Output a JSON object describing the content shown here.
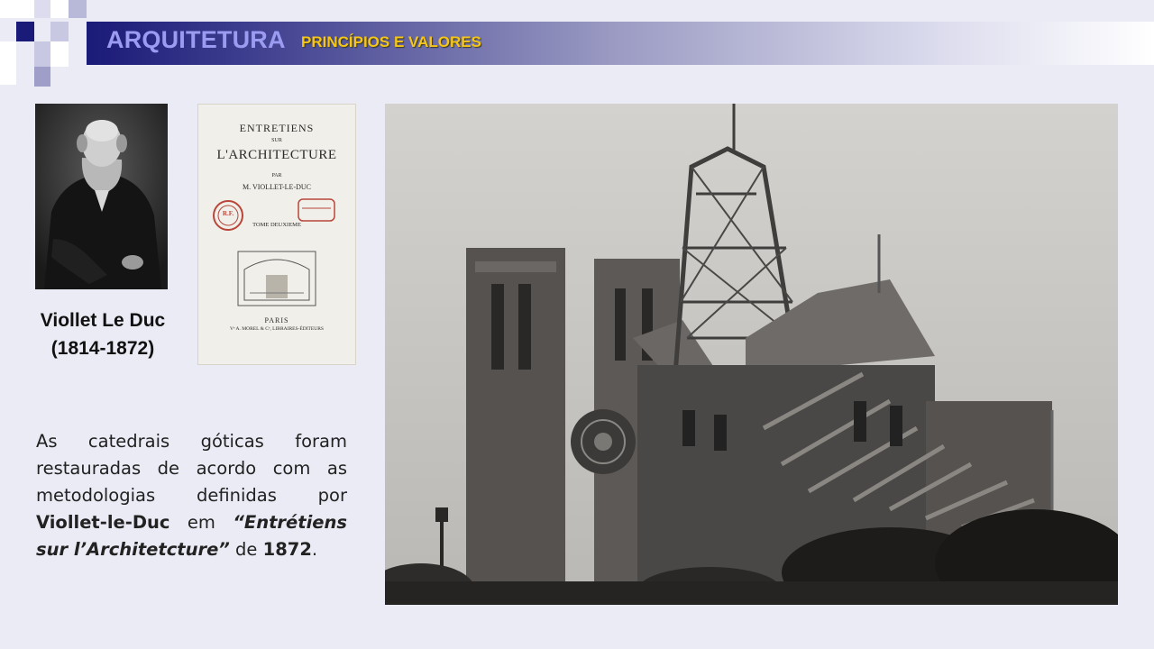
{
  "slide": {
    "title": "ARQUITETURA",
    "subtitle": "PRINCÍPIOS E VALORES"
  },
  "portrait": {
    "caption_name": "Viollet Le Duc",
    "caption_dates": "(1814-1872)"
  },
  "book": {
    "line1": "ENTRETIENS",
    "line2": "SUR",
    "line3": "L'ARCHITECTURE",
    "line4": "PAR",
    "line5": "M. VIOLLET-LE-DUC",
    "line6": "TOME DEUXIEME",
    "line7": "PARIS",
    "line8": "Vᵉ A. MOREL & Cᵉ, LIBRAIRES-ÉDITEURS",
    "stamp": "R.F."
  },
  "body": {
    "part1": "As catedrais góticas foram restauradas de acordo com as metodologias definidas por ",
    "name": "Viollet-le-Duc",
    "part2": " em ",
    "work": "“Entrétiens sur l’Architetcture”",
    "part3": " de ",
    "year": "1872",
    "part4": "."
  },
  "colors": {
    "title_main": "#9b9bf2",
    "title_sub": "#f5c518",
    "title_bar_start": "#1a1a78",
    "background": "#ebebf5"
  }
}
